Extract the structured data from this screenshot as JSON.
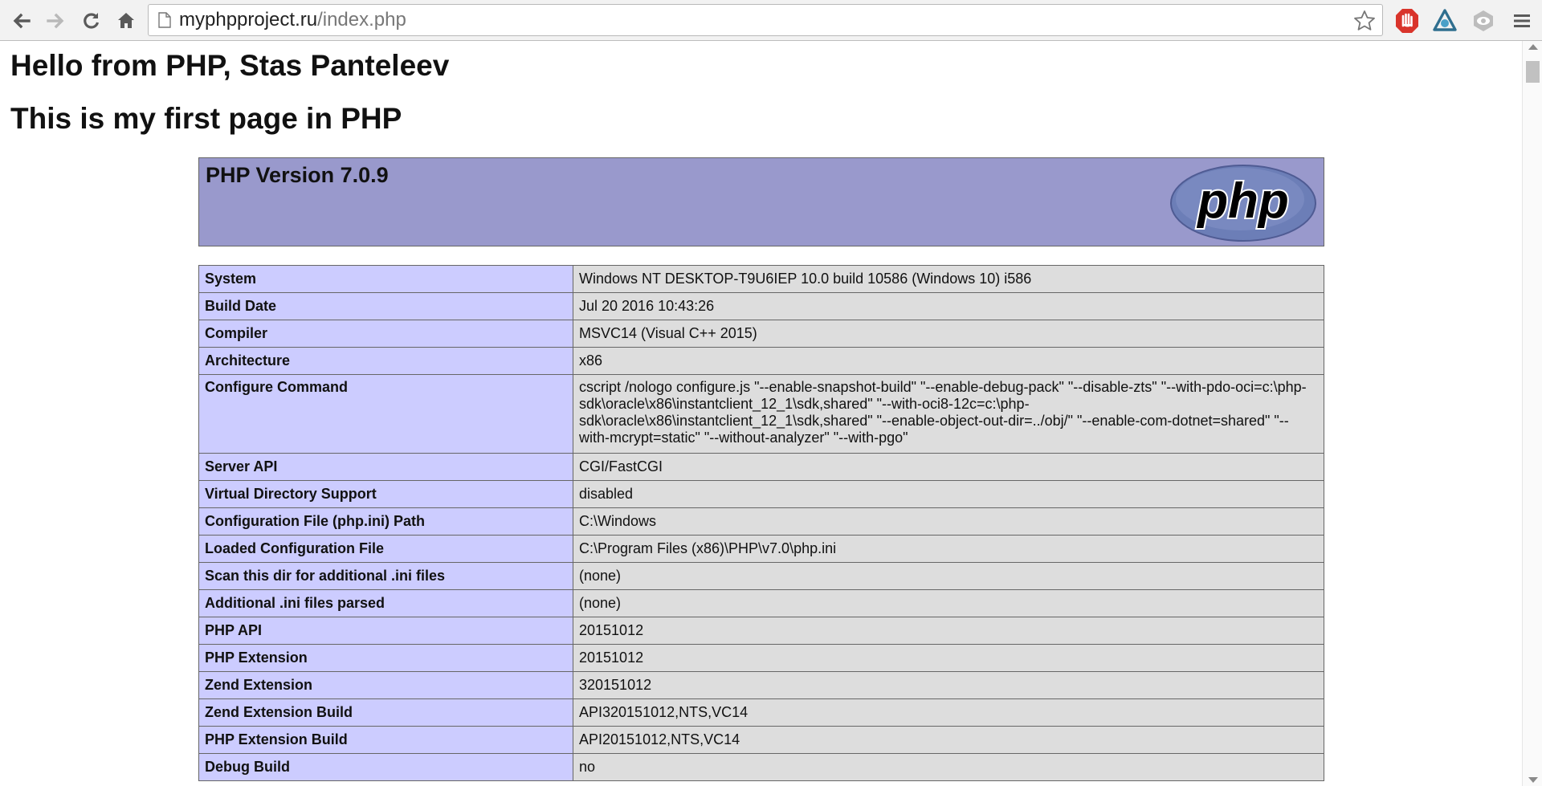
{
  "browser": {
    "url_host": "myphpproject.ru",
    "url_path": "/index.php",
    "icons": [
      "back-icon",
      "forward-icon",
      "reload-icon",
      "home-icon",
      "page-icon",
      "bookmark-star-icon",
      "adblock-extension-icon",
      "extension-icon",
      "eye-extension-icon",
      "menu-icon"
    ]
  },
  "page": {
    "heading1": "Hello from PHP, Stas Panteleev",
    "heading2": "This is my first page in PHP"
  },
  "phpinfo": {
    "version_title": "PHP Version 7.0.9",
    "logo_text": "php",
    "rows": [
      {
        "key": "System",
        "value": "Windows NT DESKTOP-T9U6IEP 10.0 build 10586 (Windows 10) i586"
      },
      {
        "key": "Build Date",
        "value": "Jul 20 2016 10:43:26"
      },
      {
        "key": "Compiler",
        "value": "MSVC14 (Visual C++ 2015)"
      },
      {
        "key": "Architecture",
        "value": "x86"
      },
      {
        "key": "Configure Command",
        "value": "cscript /nologo configure.js \"--enable-snapshot-build\" \"--enable-debug-pack\" \"--disable-zts\" \"--with-pdo-oci=c:\\php-sdk\\oracle\\x86\\instantclient_12_1\\sdk,shared\" \"--with-oci8-12c=c:\\php-sdk\\oracle\\x86\\instantclient_12_1\\sdk,shared\" \"--enable-object-out-dir=../obj/\" \"--enable-com-dotnet=shared\" \"--with-mcrypt=static\" \"--without-analyzer\" \"--with-pgo\""
      },
      {
        "key": "Server API",
        "value": "CGI/FastCGI"
      },
      {
        "key": "Virtual Directory Support",
        "value": "disabled"
      },
      {
        "key": "Configuration File (php.ini) Path",
        "value": "C:\\Windows"
      },
      {
        "key": "Loaded Configuration File",
        "value": "C:\\Program Files (x86)\\PHP\\v7.0\\php.ini"
      },
      {
        "key": "Scan this dir for additional .ini files",
        "value": "(none)"
      },
      {
        "key": "Additional .ini files parsed",
        "value": "(none)"
      },
      {
        "key": "PHP API",
        "value": "20151012"
      },
      {
        "key": "PHP Extension",
        "value": "20151012"
      },
      {
        "key": "Zend Extension",
        "value": "320151012"
      },
      {
        "key": "Zend Extension Build",
        "value": "API320151012,NTS,VC14"
      },
      {
        "key": "PHP Extension Build",
        "value": "API20151012,NTS,VC14"
      },
      {
        "key": "Debug Build",
        "value": "no"
      }
    ]
  }
}
